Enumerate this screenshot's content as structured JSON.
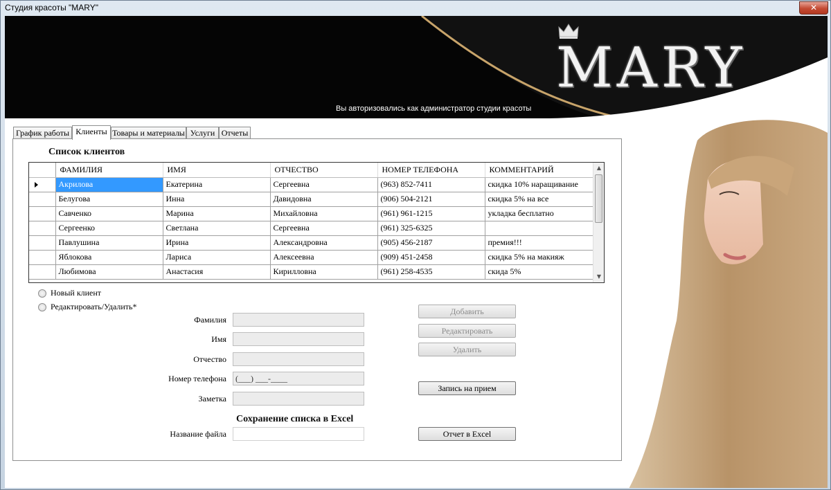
{
  "window": {
    "title": "Студия красоты \"MARY\"",
    "close_glyph": "✕"
  },
  "banner": {
    "logo": "MARY",
    "message": "Вы авторизовались как администратор студии красоты"
  },
  "tabs": [
    {
      "label": "График работы"
    },
    {
      "label": "Клиенты"
    },
    {
      "label": "Товары и материалы"
    },
    {
      "label": "Услуги"
    },
    {
      "label": "Отчеты"
    }
  ],
  "clients": {
    "title": "Список клиентов",
    "columns": [
      "ФАМИЛИЯ",
      "ИМЯ",
      "ОТЧЕСТВО",
      "НОМЕР ТЕЛЕФОНА",
      "КОММЕНТАРИЙ"
    ],
    "rows": [
      [
        "Акрилова",
        "Екатерина",
        "Сергеевна",
        "(963) 852-7411",
        "скидка 10% наращивание"
      ],
      [
        "Белугова",
        "Инна",
        "Давидовна",
        "(906) 504-2121",
        "скидка 5% на все"
      ],
      [
        "Савченко",
        "Марина",
        "Михайловна",
        "(961) 961-1215",
        "укладка бесплатно"
      ],
      [
        "Сергеенко",
        "Светлана",
        "Сергеевна",
        "(961) 325-6325",
        ""
      ],
      [
        "Павлушина",
        "Ирина",
        "Александровна",
        "(905) 456-2187",
        "премия!!!"
      ],
      [
        "Яблокова",
        "Лариса",
        "Алексеевна",
        "(909) 451-2458",
        "скидка 5% на макияж"
      ],
      [
        "Любимова",
        "Анастасия",
        "Кирилловна",
        "(961) 258-4535",
        "скида 5%"
      ]
    ]
  },
  "mode": {
    "new_client": "Новый клиент",
    "edit_delete": "Редактировать/Удалить*"
  },
  "form": {
    "last_name_label": "Фамилия",
    "first_name_label": "Имя",
    "patronymic_label": "Отчество",
    "phone_label": "Номер телефона",
    "phone_mask": "(___) ___-____",
    "note_label": "Заметка"
  },
  "buttons": {
    "add": "Добавить",
    "edit": "Редактировать",
    "delete": "Удалить",
    "appointment": "Запись на прием",
    "excel_report": "Отчет в Excel"
  },
  "excel": {
    "title": "Сохранение списка в Excel",
    "filename_label": "Название файла"
  },
  "colors": {
    "selection": "#3399ff",
    "banner_bg": "#050505",
    "accent_gold": "#c8a46a"
  },
  "icons": [
    "close-icon",
    "crown-icon",
    "row-pointer-icon",
    "scroll-up-icon",
    "scroll-down-icon"
  ]
}
